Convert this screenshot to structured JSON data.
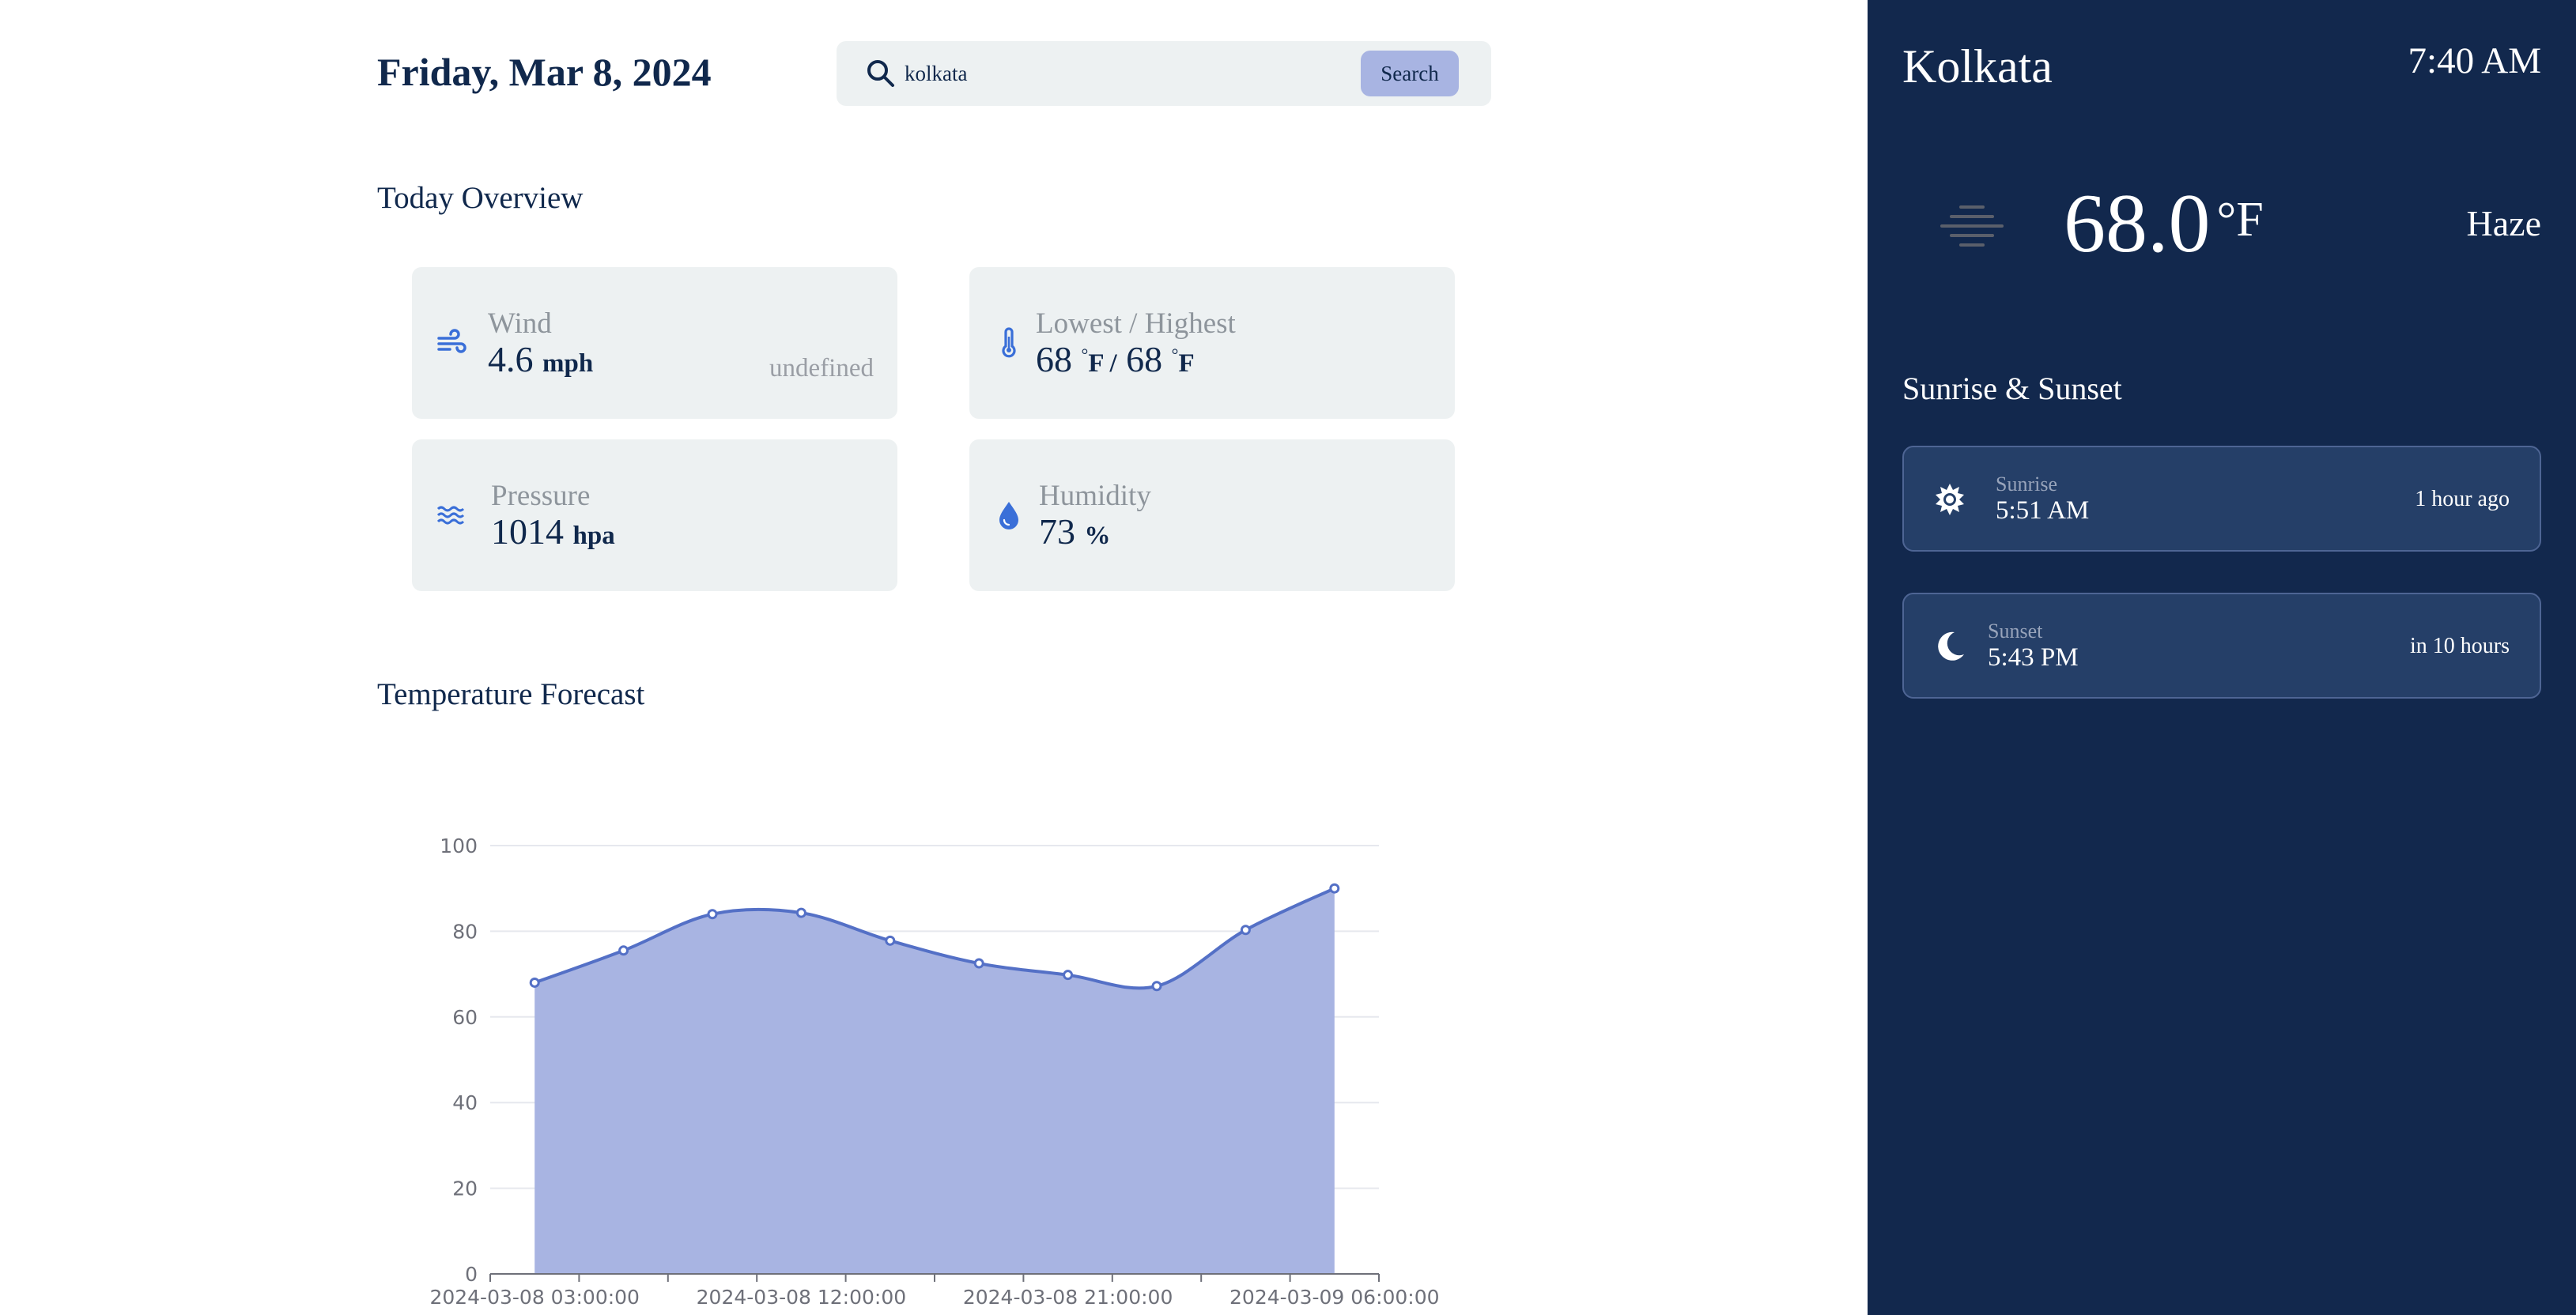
{
  "header": {
    "date": "Friday, Mar 8, 2024"
  },
  "search": {
    "value": "kolkata",
    "button_label": "Search"
  },
  "overview": {
    "title": "Today Overview",
    "wind": {
      "label": "Wind",
      "value": "4.6",
      "unit": "mph",
      "extra": "undefined"
    },
    "temp_range": {
      "label": "Lowest / Highest",
      "low": "68",
      "high": "68",
      "unit": "F",
      "separator": "/"
    },
    "pressure": {
      "label": "Pressure",
      "value": "1014",
      "unit": "hpa"
    },
    "humidity": {
      "label": "Humidity",
      "value": "73",
      "unit": "%"
    }
  },
  "forecast": {
    "title": "Temperature Forecast"
  },
  "chart_data": {
    "type": "area",
    "x": [
      "2024-03-08 03:00:00",
      "2024-03-08 06:00:00",
      "2024-03-08 09:00:00",
      "2024-03-08 12:00:00",
      "2024-03-08 15:00:00",
      "2024-03-08 18:00:00",
      "2024-03-08 21:00:00",
      "2024-03-09 00:00:00",
      "2024-03-09 03:00:00",
      "2024-03-09 06:00:00"
    ],
    "x_tick_labels": [
      "2024-03-08 03:00:00",
      "2024-03-08 12:00:00",
      "2024-03-08 21:00:00",
      "2024-03-09 06:00:00"
    ],
    "values": [
      68,
      75.5,
      84,
      84.3,
      77.8,
      72.5,
      69.8,
      67.2,
      80.3,
      90
    ],
    "ylim": [
      0,
      100
    ],
    "y_ticks": [
      0,
      20,
      40,
      60,
      80,
      100
    ],
    "grid": true,
    "color": "#5470c6",
    "fill_color": "#a8b4e2"
  },
  "weather": {
    "city": "Kolkata",
    "time": "7:40 AM",
    "temperature": "68.0",
    "unit": "°F",
    "condition": "Haze",
    "icon": "haze-icon"
  },
  "sun": {
    "title": "Sunrise & Sunset",
    "sunrise": {
      "label": "Sunrise",
      "time": "5:51 AM",
      "relative": "1 hour ago",
      "icon": "sun-icon"
    },
    "sunset": {
      "label": "Sunset",
      "time": "5:43 PM",
      "relative": "in 10 hours",
      "icon": "moon-icon"
    }
  },
  "colors": {
    "panel_bg": "#12284d",
    "card_bg": "#edf1f2",
    "accent": "#3a6fd8",
    "button": "#a8b4e2",
    "text": "#10284c"
  }
}
